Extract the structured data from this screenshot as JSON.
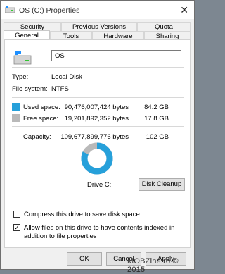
{
  "window": {
    "title": "OS (C:) Properties",
    "close_glyph": "✕"
  },
  "tabs_row1": [
    "Security",
    "Previous Versions",
    "Quota"
  ],
  "tabs_row2": [
    "General",
    "Tools",
    "Hardware",
    "Sharing"
  ],
  "general": {
    "drive_name": "OS",
    "type_label": "Type:",
    "type_value": "Local Disk",
    "fs_label": "File system:",
    "fs_value": "NTFS",
    "used": {
      "label": "Used space:",
      "bytes": "90,476,007,424 bytes",
      "size": "84.2 GB",
      "color": "#26a0da",
      "fraction": 0.82
    },
    "free": {
      "label": "Free space:",
      "bytes": "19,201,892,352 bytes",
      "size": "17.8 GB",
      "color": "#b9b9b9"
    },
    "capacity": {
      "label": "Capacity:",
      "bytes": "109,677,899,776 bytes",
      "size": "102 GB"
    },
    "drive_caption": "Drive C:",
    "cleanup_label": "Disk Cleanup",
    "compress_label": "Compress this drive to save disk space",
    "compress_checked": false,
    "index_label": "Allow files on this drive to have contents indexed in addition to file properties",
    "index_checked": true,
    "check_glyph": "✓"
  },
  "buttons": {
    "ok": "OK",
    "cancel": "Cancel",
    "apply": "Apply"
  },
  "watermark": "MOBZine.ro © 2015"
}
